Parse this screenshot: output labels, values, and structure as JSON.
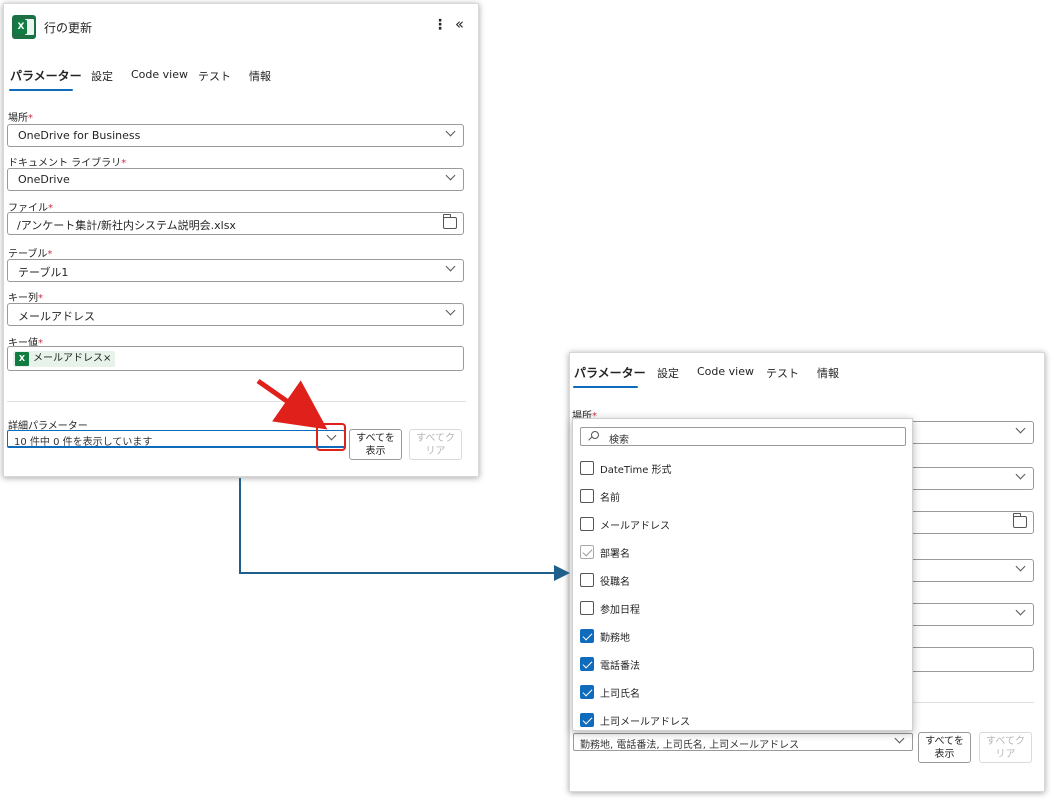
{
  "left_panel": {
    "title": "行の更新",
    "app_icon": "excel-icon",
    "tabs": [
      {
        "label": "パラメーター",
        "active": true
      },
      {
        "label": "設定"
      },
      {
        "label": "Code view"
      },
      {
        "label": "テスト"
      },
      {
        "label": "情報"
      }
    ],
    "fields": [
      {
        "label": "場所",
        "required": "*",
        "value": "OneDrive for Business",
        "type": "dropdown"
      },
      {
        "label": "ドキュメント ライブラリ",
        "required": "*",
        "value": "OneDrive",
        "type": "dropdown"
      },
      {
        "label": "ファイル",
        "required": "*",
        "value": "/アンケート集計/新社内システム説明会.xlsx",
        "type": "file-picker"
      },
      {
        "label": "テーブル",
        "required": "*",
        "value": "テーブル1",
        "type": "dropdown"
      },
      {
        "label": "キー列",
        "required": "*",
        "value": "メールアドレス",
        "type": "dropdown"
      },
      {
        "label": "キー値",
        "required": "*",
        "token": "メールアドレス",
        "token_remove": "×",
        "type": "token"
      }
    ],
    "advanced": {
      "label": "詳細パラメーター",
      "summary": "10 件中 0 件を表示しています",
      "show_all": "すべてを\n表示",
      "clear_all": "すべてク\nリア"
    }
  },
  "right_panel": {
    "tabs": [
      {
        "label": "パラメーター",
        "active": true
      },
      {
        "label": "設定"
      },
      {
        "label": "Code view"
      },
      {
        "label": "テスト"
      },
      {
        "label": "情報"
      }
    ],
    "field_label": "場所",
    "required": "*",
    "advanced": {
      "summary": "勤務地, 電話番法, 上司氏名, 上司メールアドレス",
      "show_all": "すべてを\n表示",
      "clear_all": "すべてク\nリア"
    }
  },
  "dropdown": {
    "search_placeholder": "検索",
    "options": [
      {
        "label": "DateTime 形式",
        "state": "unchecked"
      },
      {
        "label": "名前",
        "state": "unchecked"
      },
      {
        "label": "メールアドレス",
        "state": "unchecked"
      },
      {
        "label": "部署名",
        "state": "disabled-checked"
      },
      {
        "label": "役職名",
        "state": "unchecked"
      },
      {
        "label": "参加日程",
        "state": "unchecked"
      },
      {
        "label": "勤務地",
        "state": "checked"
      },
      {
        "label": "電話番法",
        "state": "checked"
      },
      {
        "label": "上司氏名",
        "state": "checked"
      },
      {
        "label": "上司メールアドレス",
        "state": "checked"
      }
    ]
  },
  "colors": {
    "accent": "#0f6cbd",
    "excel_green": "#107c41",
    "annotation_red": "#e0201a",
    "connector_blue": "#1f5f8b"
  }
}
